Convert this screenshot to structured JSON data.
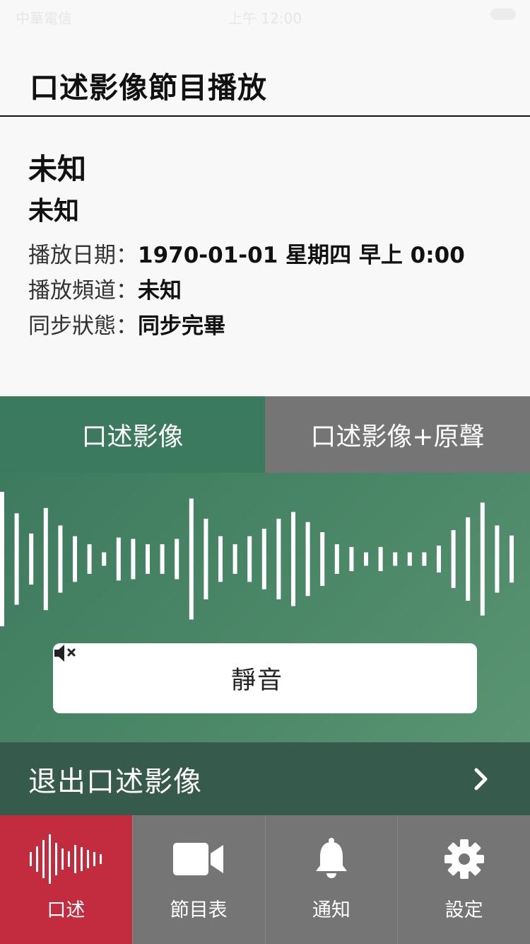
{
  "status_bar": {
    "carrier": "中華電信",
    "time": "上午 12:00"
  },
  "header": {
    "title": "口述影像節目播放"
  },
  "program": {
    "title": "未知",
    "subtitle": "未知",
    "rows": [
      {
        "label": "播放日期：",
        "value": "1970-01-01 星期四 早上 0:00"
      },
      {
        "label": "播放頻道：",
        "value": "未知"
      },
      {
        "label": "同步狀態：",
        "value": "同步完畢"
      }
    ]
  },
  "mode_tabs": [
    {
      "label": "口述影像",
      "active": true
    },
    {
      "label": "口述影像+原聲",
      "active": false
    }
  ],
  "waveform": {
    "amplitudes": [
      1.0,
      0.68,
      0.38,
      0.76,
      0.5,
      0.34,
      0.22,
      0.1,
      0.32,
      0.3,
      0.22,
      0.22,
      0.3,
      0.9,
      0.6,
      0.34,
      0.22,
      0.34,
      0.45,
      0.6,
      0.7,
      0.55,
      0.4,
      0.22,
      0.18,
      0.1,
      0.18,
      0.1,
      0.1,
      0.1,
      0.2,
      0.43,
      0.62,
      0.84,
      0.5,
      0.35
    ]
  },
  "mute_button": {
    "label": "靜音",
    "icon": "speaker-mute-icon"
  },
  "exit": {
    "label": "退出口述影像",
    "icon": "chevron-right-icon"
  },
  "tab_bar": [
    {
      "label": "口述",
      "icon": "soundwave-icon",
      "active": true
    },
    {
      "label": "節目表",
      "icon": "video-camera-icon",
      "active": false
    },
    {
      "label": "通知",
      "icon": "bell-icon",
      "active": false
    },
    {
      "label": "設定",
      "icon": "gear-icon",
      "active": false
    }
  ],
  "colors": {
    "accent_green": "#3b7a5f",
    "exit_bar": "#365a4b",
    "tab_active_red": "#c22c3e",
    "tab_inactive_gray": "#757575"
  }
}
